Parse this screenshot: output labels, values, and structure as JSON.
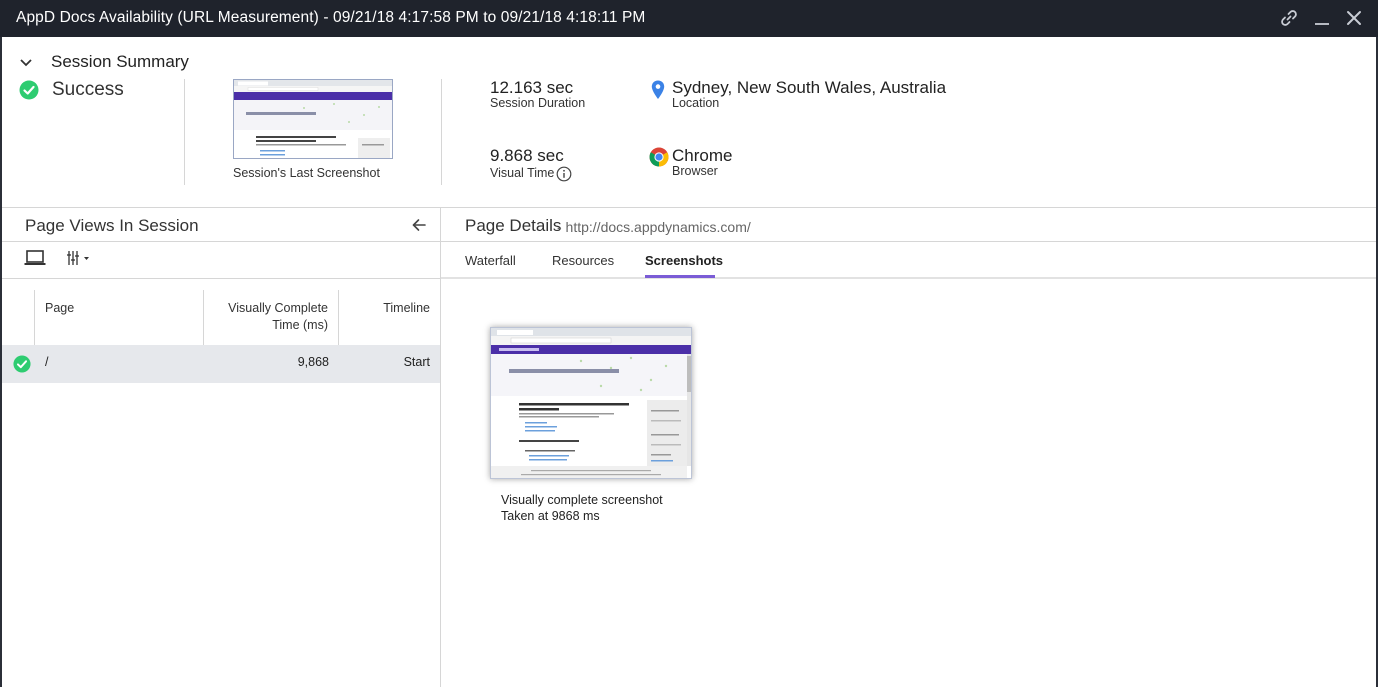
{
  "window": {
    "title": "AppD Docs Availability (URL Measurement) - 09/21/18 4:17:58 PM to 09/21/18 4:18:11 PM"
  },
  "summary": {
    "title": "Session Summary",
    "status": "Success",
    "last_screenshot_label": "Session's Last Screenshot",
    "session_duration": {
      "value": "12.163 sec",
      "label": "Session Duration"
    },
    "visual_time": {
      "value": "9.868 sec",
      "label": "Visual Time"
    },
    "location": {
      "value": "Sydney, New South Wales, Australia",
      "label": "Location"
    },
    "browser": {
      "value": "Chrome",
      "label": "Browser"
    }
  },
  "page_views": {
    "title": "Page Views In Session",
    "columns": [
      "Page",
      "Visually Complete",
      "Time (ms)",
      "Timeline"
    ],
    "rows": [
      {
        "page": "/",
        "visually_complete_ms": "9,868",
        "timeline": "Start"
      }
    ]
  },
  "page_details": {
    "title": "Page Details",
    "url": "- http://docs.appdynamics.com/",
    "tabs": [
      "Waterfall",
      "Resources",
      "Screenshots"
    ],
    "active_tab": "Screenshots",
    "screenshot": {
      "caption_line1": "Visually complete screenshot",
      "caption_line2": "Taken at 9868 ms"
    }
  },
  "colors": {
    "titlebar": "#1f232c",
    "success": "#2ecc71",
    "accent": "#7b5cd6",
    "row_highlight": "#e6e8ec"
  }
}
